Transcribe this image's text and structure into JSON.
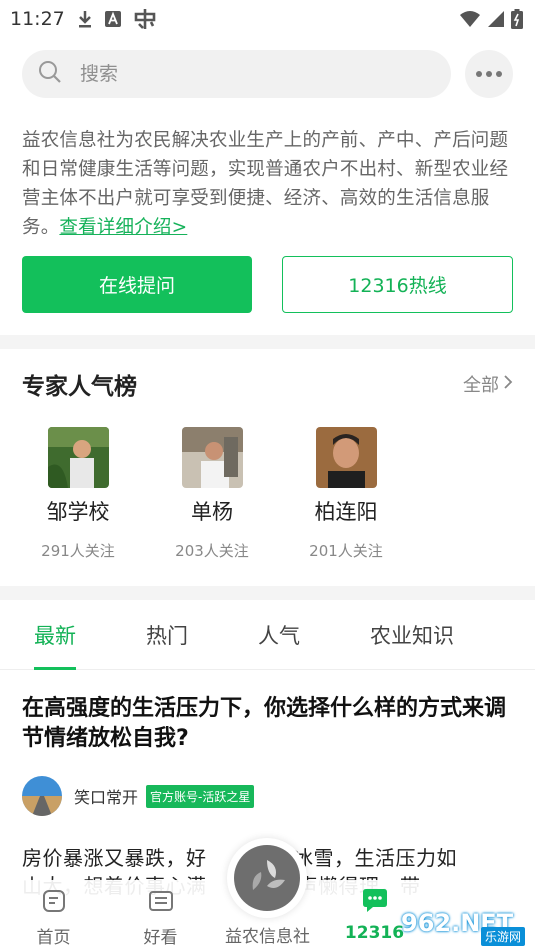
{
  "status_bar": {
    "time": "11:27",
    "icons": [
      "download-icon",
      "a-icon",
      "app-icon",
      "wifi-icon",
      "signal-icon",
      "battery-icon"
    ]
  },
  "search": {
    "placeholder": "搜索"
  },
  "intro": {
    "text": "益农信息社为农民解决农业生产上的产前、产中、产后问题和日常健康生活等问题，实现普通农户不出村、新型农业经营主体不出户就可享受到便捷、经济、高效的生活信息服务。",
    "link": "查看详细介绍>"
  },
  "actions": {
    "ask_online": "在线提问",
    "hotline": "12316热线"
  },
  "experts": {
    "title": "专家人气榜",
    "all_label": "全部",
    "items": [
      {
        "name": "邹学校",
        "followers": "291人关注"
      },
      {
        "name": "单杨",
        "followers": "203人关注"
      },
      {
        "name": "柏连阳",
        "followers": "201人关注"
      }
    ]
  },
  "tabs": [
    "最新",
    "热门",
    "人气",
    "农业知识"
  ],
  "post": {
    "title": "在高强度的生活压力下，你选择什么样的方式来调节情绪放松自我?",
    "author": "笑口常开",
    "badge": "官方账号-活跃之星",
    "body_line1": "房价暴涨又暴跌，好",
    "body_line1_end": "遇冰雪，生活压力如",
    "body_line2": "山大，想着价事心满",
    "body_line2_end": "双一声懒得理，带"
  },
  "bottom_nav": {
    "items": [
      {
        "label": "首页"
      },
      {
        "label": "好看"
      },
      {
        "label": "益农信息社"
      },
      {
        "label": "12316"
      },
      {
        "label": ""
      }
    ]
  },
  "watermark": {
    "text": "962.NET",
    "sub": "乐游网"
  },
  "colors": {
    "accent": "#13c05b",
    "link": "#16b25a"
  }
}
